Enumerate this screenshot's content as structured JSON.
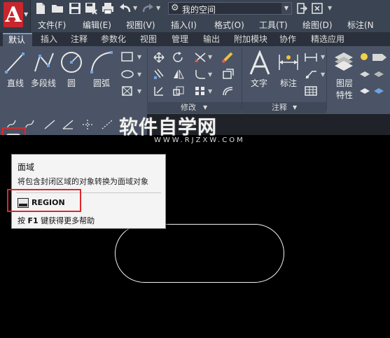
{
  "workspace": {
    "label": "我的空间"
  },
  "menu": [
    {
      "label": "文件(F)"
    },
    {
      "label": "编辑(E)"
    },
    {
      "label": "视图(V)"
    },
    {
      "label": "插入(I)"
    },
    {
      "label": "格式(O)"
    },
    {
      "label": "工具(T)"
    },
    {
      "label": "绘图(D)"
    },
    {
      "label": "标注(N"
    }
  ],
  "tabs": [
    {
      "label": "默认"
    },
    {
      "label": "插入"
    },
    {
      "label": "注释"
    },
    {
      "label": "参数化"
    },
    {
      "label": "视图"
    },
    {
      "label": "管理"
    },
    {
      "label": "输出"
    },
    {
      "label": "附加模块"
    },
    {
      "label": "协作"
    },
    {
      "label": "精选应用"
    }
  ],
  "ribbon": {
    "line": "直线",
    "polyline": "多段线",
    "circle": "圆",
    "arc": "圆弧",
    "text": "文字",
    "dimension": "标注",
    "layer_props_1": "图层",
    "layer_props_2": "特性",
    "panel_modify": "修改",
    "panel_annotation": "注释"
  },
  "tooltip": {
    "title": "面域",
    "description": "将包含封闭区域的对象转换为面域对象",
    "command": "REGION",
    "help_prefix": "按",
    "help_key": "F1",
    "help_suffix": "键获得更多帮助"
  },
  "watermark": {
    "main": "软件自学网",
    "sub": "WWW.RJZXW.COM"
  },
  "colors": {
    "brand_red": "#c8262d",
    "highlight_red": "#e0262b",
    "ribbon_bg": "#4a5466",
    "title_bg": "#3b4453"
  }
}
